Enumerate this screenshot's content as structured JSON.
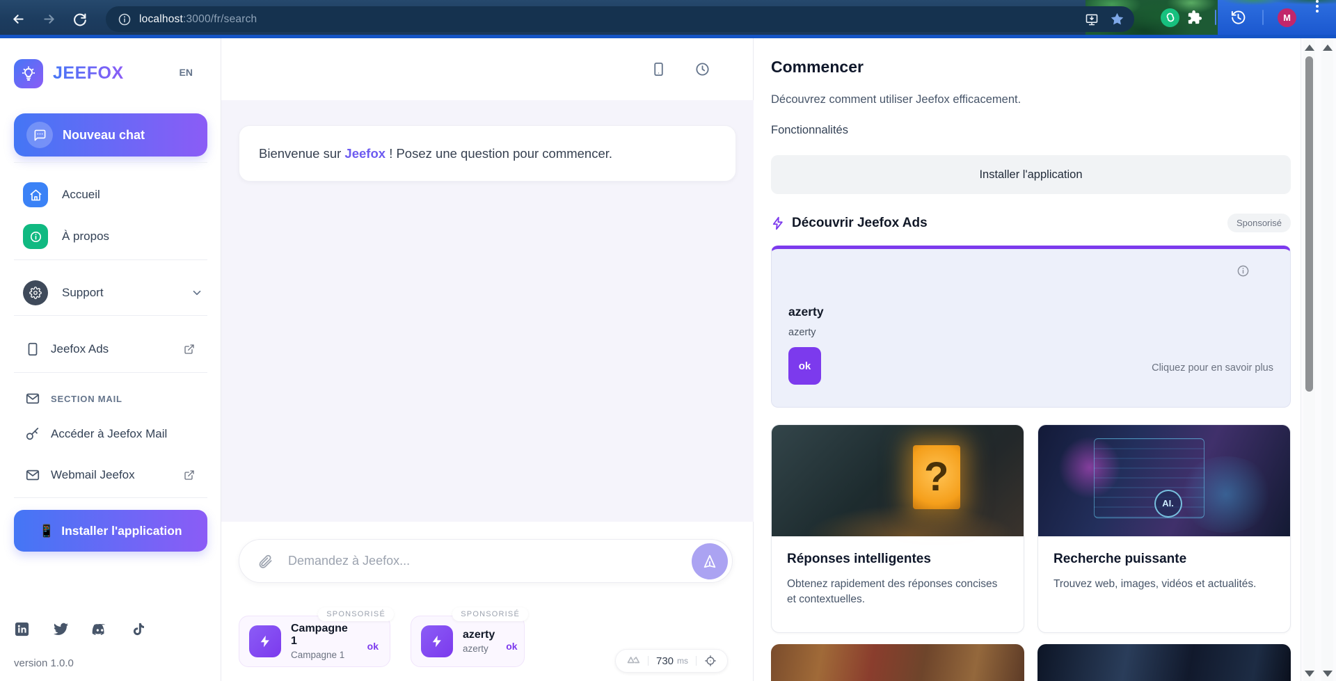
{
  "browser": {
    "host": "localhost",
    "path": ":3000/fr/search",
    "avatar_initial": "M"
  },
  "sidebar": {
    "brand": "JEEFOX",
    "language": "EN",
    "new_chat": "Nouveau chat",
    "nav": [
      {
        "label": "Accueil"
      },
      {
        "label": "À propos"
      },
      {
        "label": "Support"
      },
      {
        "label": "Jeefox Ads"
      }
    ],
    "mail_header": "SECTION MAIL",
    "mail": [
      {
        "label": "Accéder à Jeefox Mail"
      },
      {
        "label": "Webmail Jeefox"
      }
    ],
    "install": "Installer l'application",
    "phone_emoji": "📱",
    "version": "version 1.0.0"
  },
  "chat": {
    "welcome_prefix": "Bienvenue sur",
    "welcome_brand": "Jeefox",
    "welcome_suffix": "! Posez une question pour commencer.",
    "placeholder": "Demandez à Jeefox...",
    "latency_value": "730",
    "latency_unit": "ms",
    "chips": [
      {
        "badge": "SPONSORISÉ",
        "title": "Campagne 1",
        "subtitle": "Campagne 1",
        "action": "ok"
      },
      {
        "badge": "SPONSORISÉ",
        "title": "azerty",
        "subtitle": "azerty",
        "action": "ok"
      }
    ]
  },
  "panel": {
    "title": "Commencer",
    "subtitle": "Découvrez comment utiliser Jeefox efficacement.",
    "features_label": "Fonctionnalités",
    "install_button": "Installer l'application",
    "ads_header": "Découvrir Jeefox Ads",
    "sponsored_badge": "Sponsorisé",
    "ad": {
      "title": "azerty",
      "subtitle": "azerty",
      "action": "ok",
      "more": "Cliquez pour en savoir plus"
    },
    "cards": [
      {
        "title": "Réponses intelligentes",
        "desc": "Obtenez rapidement des réponses concises et contextuelles."
      },
      {
        "title": "Recherche puissante",
        "desc": "Trouvez web, images, vidéos et actualités."
      }
    ],
    "ai_label": "AI."
  },
  "colors": {
    "accent": "#7c3aed",
    "gradient_from": "#4776f6",
    "gradient_to": "#8b5cf6",
    "avatar_bg": "#c2266b",
    "star": "#7fa8e8",
    "extension_green": "#17c07e"
  }
}
